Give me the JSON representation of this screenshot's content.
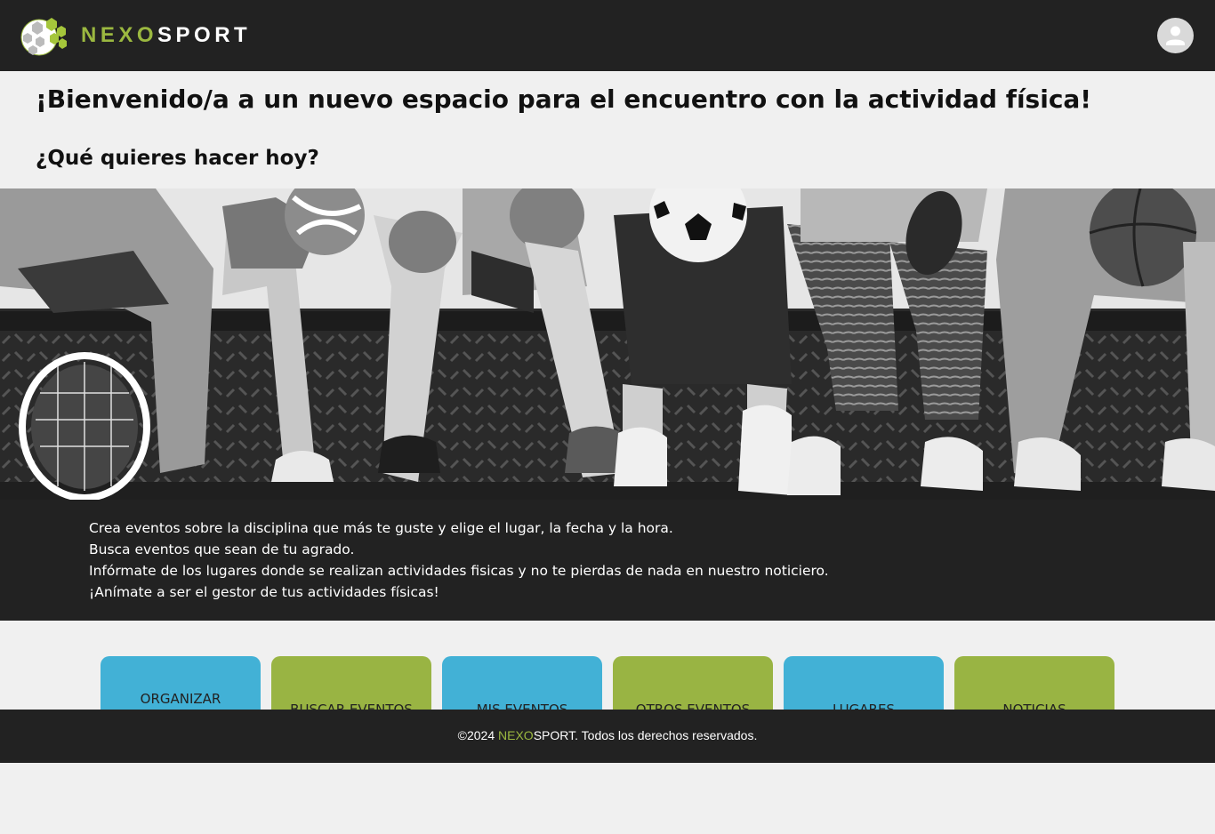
{
  "header": {
    "brand_part1": "NEXO",
    "brand_part2": "SPORT",
    "logo_icon": "soccer-ball-hexagon-logo",
    "profile_icon": "user-avatar-icon"
  },
  "main": {
    "welcome": "¡Bienvenido/a a un nuevo espacio para el encuentro con la actividad física!",
    "question": "¿Qué quieres hacer hoy?"
  },
  "info": {
    "lines": [
      "Crea eventos sobre la disciplina que más te guste y elige el lugar, la fecha y la hora.",
      "Busca eventos que sean de tu agrado.",
      "Infórmate de los lugares donde se realizan actividades fisicas y no te pierdas de nada en nuestro noticiero.",
      "¡Anímate a ser el gestor de tus actividades físicas!"
    ]
  },
  "cards": [
    {
      "label": "ORGANIZAR",
      "color": "#42b1d6"
    },
    {
      "label": "BUSCAR EVENTOS",
      "color": "#99b443"
    },
    {
      "label": "MIS EVENTOS",
      "color": "#42b1d6"
    },
    {
      "label": "OTROS EVENTOS",
      "color": "#99b443"
    },
    {
      "label": "LUGARES",
      "color": "#42b1d6"
    },
    {
      "label": "NOTICIAS",
      "color": "#99b443"
    }
  ],
  "footer": {
    "prefix": "©2024 ",
    "brand_part1": "NEXO",
    "brand_part2": "SPORT",
    "suffix": ". Todos los derechos reservados."
  },
  "colors": {
    "brand_green": "#9bb840",
    "dark_bg": "#222222",
    "card_blue": "#42b1d6",
    "card_green": "#99b443"
  }
}
